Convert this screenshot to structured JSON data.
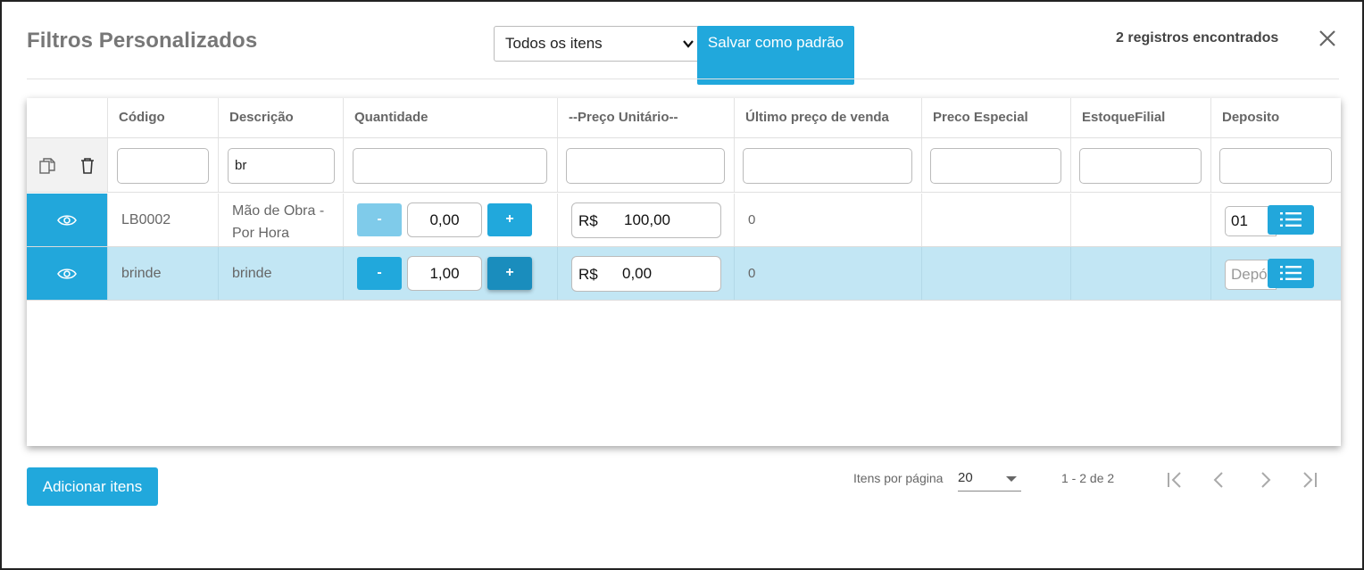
{
  "header": {
    "title": "Filtros Personalizados",
    "filter_value": "Todos os itens",
    "save_default_label": "Salvar como padrão",
    "records_count": "2 registros encontrados"
  },
  "table": {
    "columns": [
      "Código",
      "Descrição",
      "Quantidade",
      "--Preço Unitário--",
      "Último preço de venda",
      "Preco Especial",
      "EstoqueFilial",
      "Deposito"
    ],
    "filters": {
      "codigo": "",
      "descricao": "br",
      "quantidade": "",
      "preco_unitario": "",
      "ultimo_preco": "",
      "preco_especial": "",
      "estoque_filial": "",
      "deposito": ""
    },
    "rows": [
      {
        "codigo": "LB0002",
        "descricao": "Mão de Obra - Por Hora",
        "quantidade": "0,00",
        "currency": "R$",
        "preco": "100,00",
        "ultimo_preco": "0",
        "preco_especial": "",
        "estoque_filial": "",
        "deposito": "01",
        "selected": false
      },
      {
        "codigo": "brinde",
        "descricao": "brinde",
        "quantidade": "1,00",
        "currency": "R$",
        "preco": "0,00",
        "ultimo_preco": "0",
        "preco_especial": "",
        "estoque_filial": "",
        "deposito_placeholder": "Depósito",
        "selected": true
      }
    ],
    "minus_label": "-",
    "plus_label": "+"
  },
  "footer": {
    "add_items_label": "Adicionar itens",
    "items_per_page_label": "Itens por página",
    "items_per_page_value": "20",
    "range": "1 - 2 de 2"
  },
  "colors": {
    "accent": "#21a8dc",
    "accent_disabled": "#7fcbea",
    "accent_pressed": "#1a8dbd",
    "selected_row": "#c2e6f4"
  },
  "icons": [
    "chevron-down-icon",
    "close-icon",
    "copy-icon",
    "trash-icon",
    "eye-icon",
    "list-icon",
    "first-page-icon",
    "previous-page-icon",
    "next-page-icon",
    "last-page-icon"
  ]
}
